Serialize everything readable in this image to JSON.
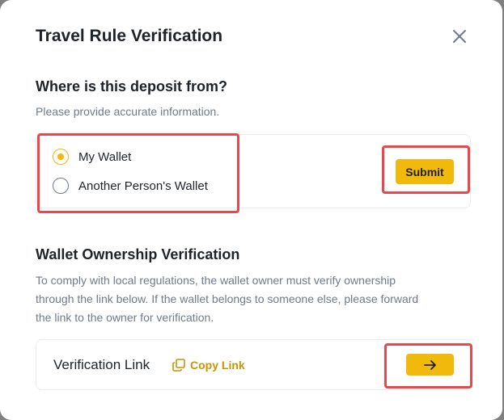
{
  "modal": {
    "title": "Travel Rule Verification"
  },
  "deposit_source": {
    "heading": "Where is this deposit from?",
    "subtext": "Please provide accurate information.",
    "options": [
      {
        "label": "My Wallet",
        "selected": true
      },
      {
        "label": "Another Person's Wallet",
        "selected": false
      }
    ],
    "submit_label": "Submit"
  },
  "ownership": {
    "heading": "Wallet Ownership Verification",
    "description_lines": [
      "To comply with local regulations, the wallet owner must verify ownership",
      "through the link below. If the wallet belongs to someone else, please forward",
      "the link to the owner for verification."
    ],
    "link_label": "Verification Link",
    "copy_label": "Copy Link"
  },
  "icons": {
    "close": "close-icon",
    "copy": "copy-icon",
    "arrow": "arrow-right-icon"
  },
  "colors": {
    "accent": "#f0b90b",
    "accent_text": "#c99400",
    "highlight": "#e5484d",
    "text_primary": "#1e2329",
    "text_secondary": "#707a8a"
  }
}
